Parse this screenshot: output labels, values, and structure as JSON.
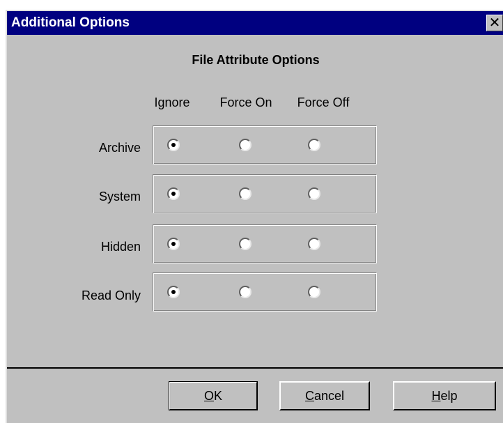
{
  "window": {
    "title": "Additional Options",
    "close_label": "✕"
  },
  "section": {
    "title": "File Attribute Options"
  },
  "columns": [
    "Ignore",
    "Force On",
    "Force Off"
  ],
  "rows": [
    {
      "label": "Archive",
      "selected": "Ignore"
    },
    {
      "label": "System",
      "selected": "Ignore"
    },
    {
      "label": "Hidden",
      "selected": "Ignore"
    },
    {
      "label": "Read Only",
      "selected": "Ignore"
    }
  ],
  "buttons": {
    "ok": {
      "mnemonic": "O",
      "rest": "K"
    },
    "cancel": {
      "mnemonic": "C",
      "rest": "ancel"
    },
    "help": {
      "mnemonic": "H",
      "rest": "elp"
    }
  },
  "colors": {
    "titlebar": "#000080",
    "face": "#c0c0c0"
  }
}
